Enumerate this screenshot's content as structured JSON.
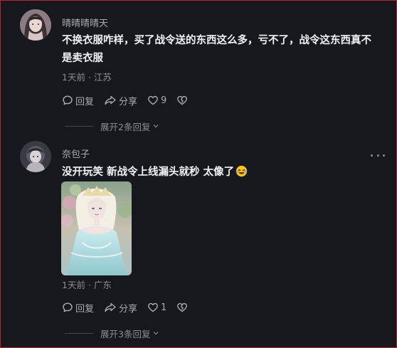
{
  "comments": [
    {
      "username": "晴晴晴晴天",
      "text": "不换衣服咋样，买了战令送的东西这么多，亏不了，战令这东西真不是卖衣服",
      "meta": "1天前 · 江苏",
      "reply_label": "回复",
      "share_label": "分享",
      "like_count": "9",
      "expand_label": "展开2条回复"
    },
    {
      "username": "奈包子",
      "text": "没开玩笑 新战令上线漏头就秒 太像了",
      "emoji": "grinning-squint-tears-emoji",
      "meta": "1天前 · 广东",
      "reply_label": "回复",
      "share_label": "分享",
      "like_count": "1",
      "expand_label": "展开3条回复"
    }
  ],
  "colors": {
    "background": "#17181d",
    "border": "#b8232d",
    "primary_text": "#f2f2f4",
    "secondary_text": "#a9aab2",
    "muted_text": "#8c8d95"
  }
}
